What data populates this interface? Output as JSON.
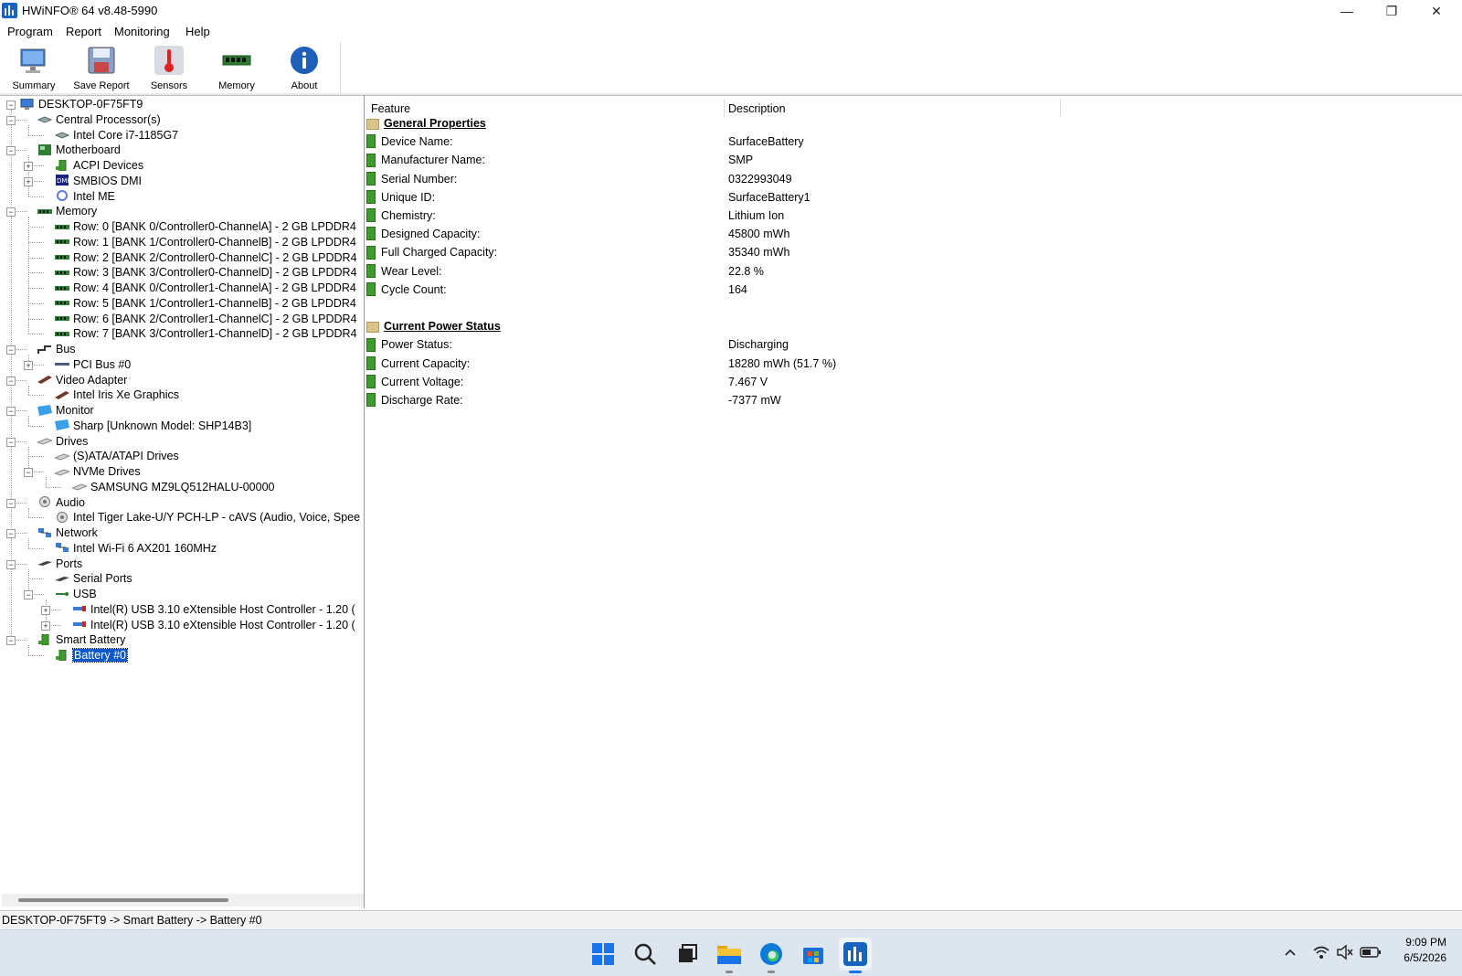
{
  "window": {
    "title": "HWiNFO® 64 v8.48-5990",
    "icon": "hwinfo-app-icon"
  },
  "window_controls": {
    "minimize": "—",
    "maximize": "❐",
    "close": "✕"
  },
  "menu": [
    "Program",
    "Report",
    "Monitoring",
    "Help"
  ],
  "toolbar": [
    {
      "label": "Summary",
      "icon": "monitor-icon"
    },
    {
      "label": "Save Report",
      "icon": "floppy-disk-icon"
    },
    {
      "label": "Sensors",
      "icon": "thermometer-icon"
    },
    {
      "label": "Memory",
      "icon": "memory-module-icon"
    },
    {
      "label": "About",
      "icon": "info-icon"
    }
  ],
  "tree": [
    {
      "label": "DESKTOP-0F75FT9",
      "icon": "computer-icon"
    },
    {
      "label": "Central Processor(s)",
      "icon": "cpu-icon"
    },
    {
      "label": "Intel Core i7-1185G7",
      "icon": "cpu-icon"
    },
    {
      "label": "Motherboard",
      "icon": "motherboard-icon"
    },
    {
      "label": "ACPI Devices",
      "icon": "battery-icon"
    },
    {
      "label": "SMBIOS DMI",
      "icon": "dmi-icon"
    },
    {
      "label": "Intel ME",
      "icon": "gear-icon"
    },
    {
      "label": "Memory",
      "icon": "memory-module-icon"
    },
    {
      "label": "Row: 0 [BANK 0/Controller0-ChannelA] - 2 GB LPDDR4",
      "icon": "memory-module-icon"
    },
    {
      "label": "Row: 1 [BANK 1/Controller0-ChannelB] - 2 GB LPDDR4",
      "icon": "memory-module-icon"
    },
    {
      "label": "Row: 2 [BANK 2/Controller0-ChannelC] - 2 GB LPDDR4",
      "icon": "memory-module-icon"
    },
    {
      "label": "Row: 3 [BANK 3/Controller0-ChannelD] - 2 GB LPDDR4",
      "icon": "memory-module-icon"
    },
    {
      "label": "Row: 4 [BANK 0/Controller1-ChannelA] - 2 GB LPDDR4",
      "icon": "memory-module-icon"
    },
    {
      "label": "Row: 5 [BANK 1/Controller1-ChannelB] - 2 GB LPDDR4",
      "icon": "memory-module-icon"
    },
    {
      "label": "Row: 6 [BANK 2/Controller1-ChannelC] - 2 GB LPDDR4",
      "icon": "memory-module-icon"
    },
    {
      "label": "Row: 7 [BANK 3/Controller1-ChannelD] - 2 GB LPDDR4",
      "icon": "memory-module-icon"
    },
    {
      "label": "Bus",
      "icon": "bus-icon"
    },
    {
      "label": "PCI Bus #0",
      "icon": "pci-icon"
    },
    {
      "label": "Video Adapter",
      "icon": "video-card-icon"
    },
    {
      "label": "Intel Iris Xe Graphics",
      "icon": "video-card-icon"
    },
    {
      "label": "Monitor",
      "icon": "monitor-icon"
    },
    {
      "label": "Sharp [Unknown Model: SHP14B3]",
      "icon": "monitor-icon"
    },
    {
      "label": "Drives",
      "icon": "drive-icon"
    },
    {
      "label": "(S)ATA/ATAPI Drives",
      "icon": "drive-icon"
    },
    {
      "label": "NVMe Drives",
      "icon": "drive-icon"
    },
    {
      "label": "SAMSUNG MZ9LQ512HALU-00000",
      "icon": "drive-icon"
    },
    {
      "label": "Audio",
      "icon": "speaker-icon"
    },
    {
      "label": "Intel Tiger Lake-U/Y PCH-LP - cAVS (Audio, Voice, Spee",
      "icon": "speaker-icon"
    },
    {
      "label": "Network",
      "icon": "network-icon"
    },
    {
      "label": "Intel Wi-Fi 6 AX201 160MHz",
      "icon": "network-icon"
    },
    {
      "label": "Ports",
      "icon": "port-icon"
    },
    {
      "label": "Serial Ports",
      "icon": "port-icon"
    },
    {
      "label": "USB",
      "icon": "usb-icon"
    },
    {
      "label": "Intel(R) USB 3.10 eXtensible Host Controller - 1.20 (",
      "icon": "usb-controller-icon"
    },
    {
      "label": "Intel(R) USB 3.10 eXtensible Host Controller - 1.20 (",
      "icon": "usb-controller-icon"
    },
    {
      "label": "Smart Battery",
      "icon": "battery-icon"
    },
    {
      "label": "Battery #0",
      "icon": "battery-icon",
      "selected": true
    }
  ],
  "details": {
    "columns": [
      "Feature",
      "Description"
    ],
    "sections": [
      {
        "title": "General Properties",
        "rows": [
          {
            "feature": "Device Name:",
            "value": "SurfaceBattery"
          },
          {
            "feature": "Manufacturer Name:",
            "value": "SMP"
          },
          {
            "feature": "Serial Number:",
            "value": "0322993049"
          },
          {
            "feature": "Unique ID:",
            "value": "SurfaceBattery1"
          },
          {
            "feature": "Chemistry:",
            "value": "Lithium Ion"
          },
          {
            "feature": "Designed Capacity:",
            "value": "45800 mWh"
          },
          {
            "feature": "Full Charged Capacity:",
            "value": "35340 mWh"
          },
          {
            "feature": "Wear Level:",
            "value": "22.8 %"
          },
          {
            "feature": "Cycle Count:",
            "value": "164"
          }
        ]
      },
      {
        "title": "Current Power Status",
        "rows": [
          {
            "feature": "Power Status:",
            "value": "Discharging"
          },
          {
            "feature": "Current Capacity:",
            "value": "18280 mWh (51.7 %)"
          },
          {
            "feature": "Current Voltage:",
            "value": "7.467 V"
          },
          {
            "feature": "Discharge Rate:",
            "value": "-7377 mW"
          }
        ]
      }
    ]
  },
  "statusbar": {
    "path": "DESKTOP-0F75FT9 -> Smart Battery -> Battery #0"
  },
  "taskbar": {
    "apps": [
      "start-icon",
      "search-icon",
      "task-view-icon",
      "file-explorer-icon",
      "edge-icon",
      "store-icon",
      "hwinfo-app-icon"
    ],
    "tray_icons": [
      "chevron-up-icon",
      "wifi-icon",
      "speaker-muted-icon",
      "battery-icon"
    ],
    "time": "9:09 PM",
    "date": "6/5/2026"
  },
  "colors": {
    "selection": "#0a58ca",
    "taskbar": "#dde6ef",
    "battery_green": "#3f9b2f"
  }
}
